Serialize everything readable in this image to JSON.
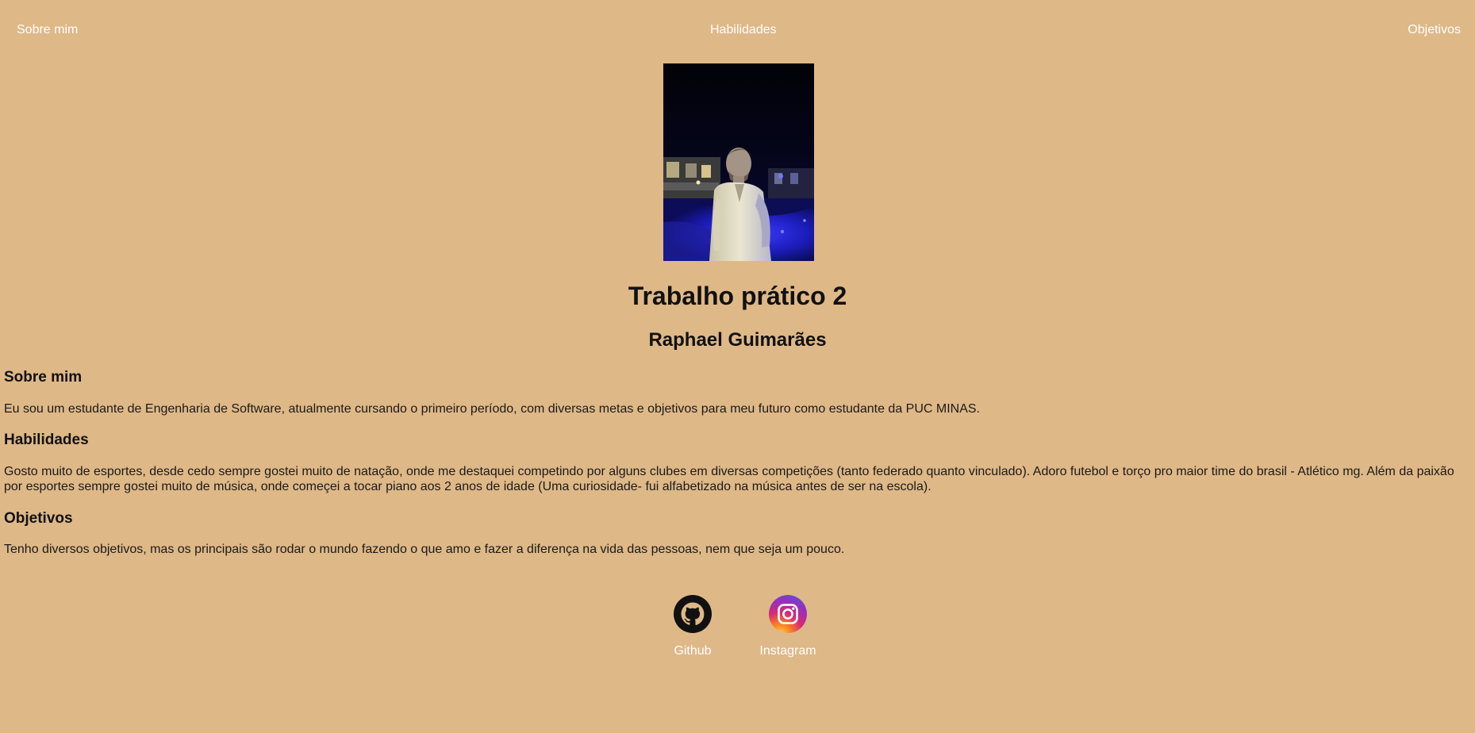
{
  "nav": {
    "items": [
      {
        "label": "Sobre mim"
      },
      {
        "label": "Habilidades"
      },
      {
        "label": "Objetivos"
      }
    ]
  },
  "header": {
    "title": "Trabalho prático 2",
    "subtitle": "Raphael Guimarães"
  },
  "sections": {
    "sobre": {
      "heading": "Sobre mim",
      "text": "Eu sou um estudante de Engenharia de Software, atualmente cursando o primeiro período, com diversas metas e objetivos para meu futuro como estudante da PUC MINAS."
    },
    "habilidades": {
      "heading": "Habilidades",
      "text": "Gosto muito de esportes, desde cedo sempre gostei muito de natação, onde me destaquei competindo por alguns clubes em diversas competições (tanto federado quanto vinculado). Adoro futebol e torço pro maior time do brasil - Atlético mg. Além da paixão por esportes sempre gostei muito de música, onde começei a tocar piano aos 2 anos de idade (Uma curiosidade- fui alfabetizado na música antes de ser na escola)."
    },
    "objetivos": {
      "heading": "Objetivos",
      "text": "Tenho diversos objetivos, mas os principais são rodar o mundo fazendo o que amo e fazer a diferença na vida das pessoas, nem que seja um pouco."
    }
  },
  "social": {
    "github": {
      "label": "Github",
      "icon": "github-icon"
    },
    "instagram": {
      "label": "Instagram",
      "icon": "instagram-icon"
    }
  },
  "colors": {
    "background": "#dfb887",
    "nav_text": "#ffffff",
    "text": "#111111"
  }
}
